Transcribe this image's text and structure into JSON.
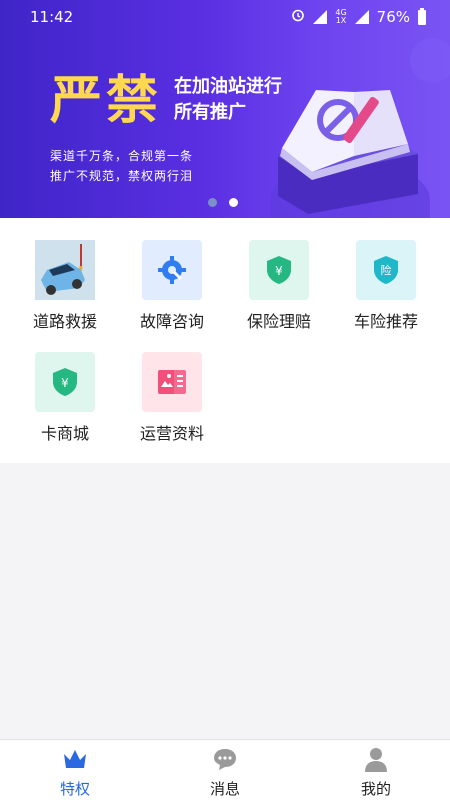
{
  "status_bar": {
    "time": "11:42",
    "network": "4G",
    "battery": "76%"
  },
  "banner": {
    "big_text": "严禁",
    "line1": "在加油站进行",
    "line2": "所有推广",
    "sub1": "渠道千万条，合规第一条",
    "sub2": "推广不规范，禁权两行泪",
    "dots": 2,
    "active_dot": 1
  },
  "grid": [
    {
      "label": "道路救援",
      "icon": "tow-truck-image",
      "bg": "#d8e6f0"
    },
    {
      "label": "故障咨询",
      "icon": "gear-icon",
      "bg": "#e1edff"
    },
    {
      "label": "保险理赔",
      "icon": "shield-yen-icon",
      "bg": "#dff6ee"
    },
    {
      "label": "车险推荐",
      "icon": "shield-insurance-icon",
      "bg": "#daf4f8"
    },
    {
      "label": "卡商城",
      "icon": "shield-yen-icon",
      "bg": "#dff6ee"
    },
    {
      "label": "运营资料",
      "icon": "document-image-icon",
      "bg": "#ffe4ea"
    }
  ],
  "tabs": [
    {
      "label": "特权",
      "icon": "crown-icon",
      "active": true
    },
    {
      "label": "消息",
      "icon": "chat-bubble-icon",
      "active": false
    },
    {
      "label": "我的",
      "icon": "user-icon",
      "active": false
    }
  ],
  "colors": {
    "accent": "#2a69e2",
    "banner_start": "#3f25c8",
    "banner_end": "#7a54f3",
    "headline": "#ffd84f"
  }
}
